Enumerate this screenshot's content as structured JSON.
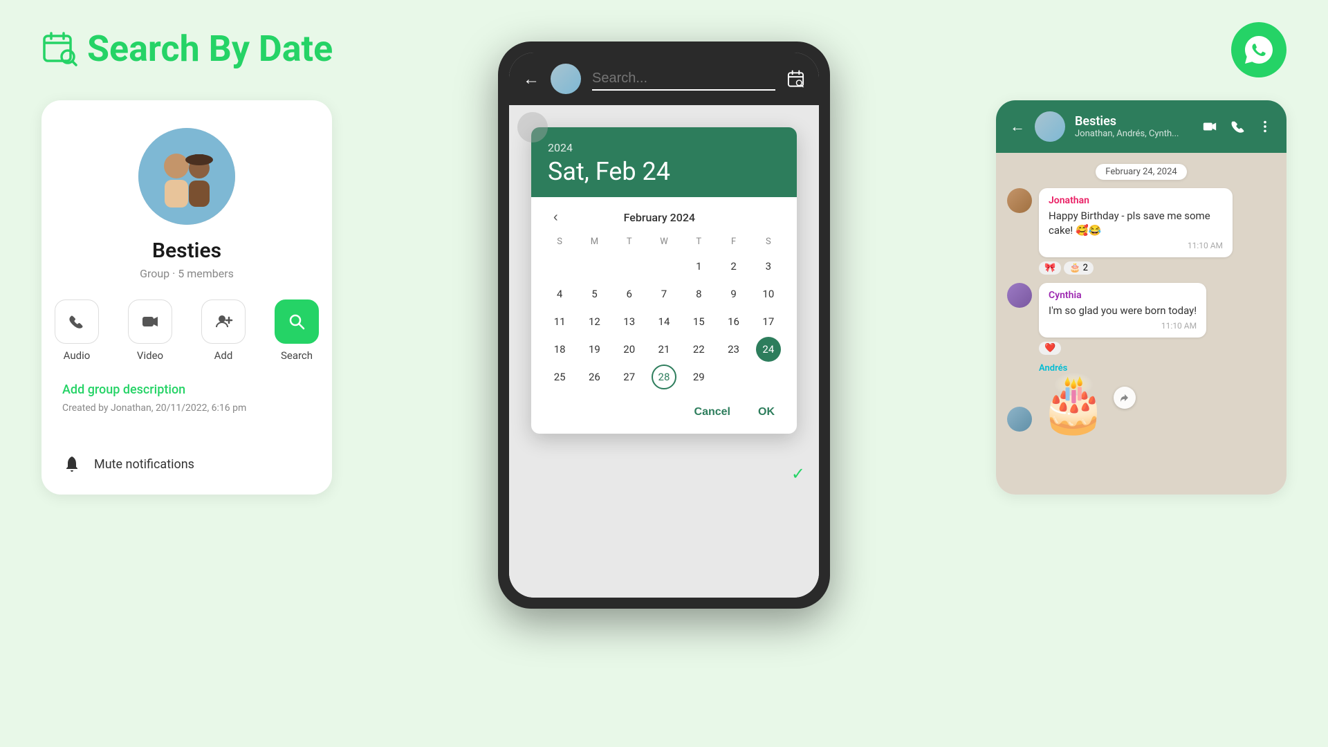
{
  "header": {
    "title_green": "Search",
    "title_rest": " By Date",
    "icon": "calendar-search-icon"
  },
  "left_card": {
    "group_name": "Besties",
    "group_meta": "Group · 5 members",
    "actions": [
      {
        "label": "Audio",
        "icon": "phone-icon",
        "active": false
      },
      {
        "label": "Video",
        "icon": "video-icon",
        "active": false
      },
      {
        "label": "Add",
        "icon": "add-person-icon",
        "active": false
      },
      {
        "label": "Search",
        "icon": "search-icon",
        "active": true
      }
    ],
    "add_description": "Add group description",
    "created_by": "Created by Jonathan, 20/11/2022, 6:16 pm",
    "mute_label": "Mute notifications"
  },
  "phone": {
    "search_placeholder": "Search...",
    "calendar": {
      "year": "2024",
      "selected_date": "Sat, Feb 24",
      "month_label": "February 2024",
      "days_header": [
        "S",
        "M",
        "T",
        "W",
        "T",
        "F",
        "S"
      ],
      "weeks": [
        [
          "",
          "",
          "",
          "",
          "1",
          "2",
          "3"
        ],
        [
          "4",
          "5",
          "6",
          "7",
          "8",
          "9",
          "10"
        ],
        [
          "11",
          "12",
          "13",
          "14",
          "15",
          "16",
          "17"
        ],
        [
          "18",
          "19",
          "20",
          "21",
          "22",
          "23",
          "24"
        ],
        [
          "25",
          "26",
          "27",
          "28",
          "29",
          "",
          ""
        ]
      ],
      "selected_day": "24",
      "circled_day": "28",
      "cancel_label": "Cancel",
      "ok_label": "OK"
    }
  },
  "right_card": {
    "chat_name": "Besties",
    "chat_members": "Jonathan, Andrés, Cynth...",
    "date_badge": "February 24, 2024",
    "messages": [
      {
        "sender": "Jonathan",
        "sender_class": "jonathan",
        "text": "Happy Birthday - pls save me some cake! 🥰😂",
        "time": "11:10 AM",
        "reactions": [
          "🎀",
          "🎂",
          "2"
        ]
      },
      {
        "sender": "Cynthia",
        "sender_class": "cynthia",
        "text": "I'm so glad you were born today!",
        "time": "11:10 AM",
        "reactions": [
          "❤️"
        ]
      },
      {
        "sender": "Andrés",
        "sender_class": "andres",
        "sticker": "🎂",
        "time": ""
      }
    ]
  }
}
